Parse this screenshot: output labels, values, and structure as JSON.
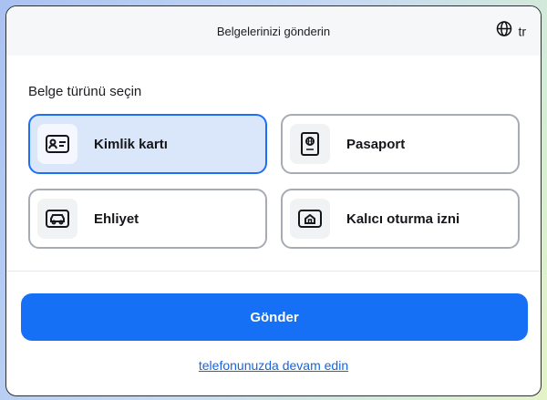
{
  "header": {
    "title": "Belgelerinizi gönderin",
    "language_code": "tr",
    "language_icon": "globe-icon"
  },
  "section_label": "Belge türünü seçin",
  "document_types": [
    {
      "label": "Kimlik kartı",
      "icon": "id-card-icon",
      "selected": true
    },
    {
      "label": "Pasaport",
      "icon": "passport-icon",
      "selected": false
    },
    {
      "label": "Ehliyet",
      "icon": "car-icon",
      "selected": false
    },
    {
      "label": "Kalıcı oturma izni",
      "icon": "home-icon",
      "selected": false
    }
  ],
  "submit_label": "Gönder",
  "phone_link": "telefonunuzda devam edin",
  "colors": {
    "accent": "#1570f5",
    "selected_bg": "#dae6fa",
    "selected_border": "#1f6ff5",
    "link": "#1665e3"
  }
}
